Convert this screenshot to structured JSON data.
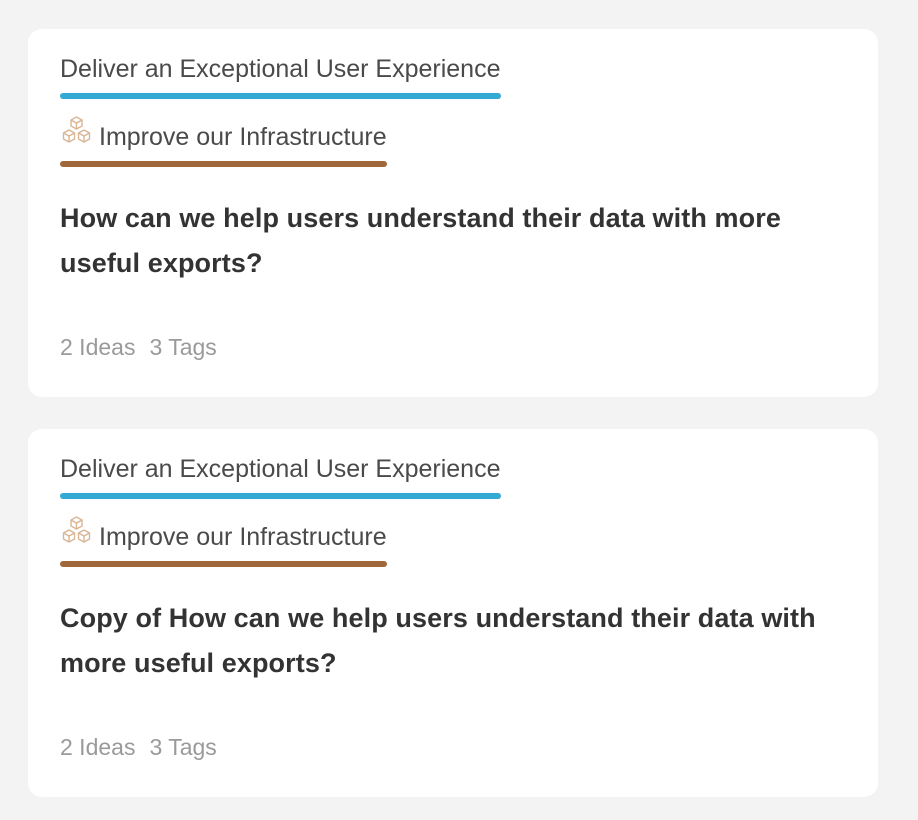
{
  "colors": {
    "page_background": "#f3f3f3",
    "card_background": "#ffffff",
    "goal_primary_bar": "#33a9d3",
    "goal_secondary_bar": "#a0673b",
    "cube_icon": "#d9b594"
  },
  "cards": [
    {
      "primary_goal": "Deliver an Exceptional User Experience",
      "secondary_goal": {
        "icon": "cubes-icon",
        "label": "Improve our Infrastructure"
      },
      "question": "How can we help users understand their data with more useful exports?",
      "ideas": "2 Ideas",
      "tags": "3 Tags"
    },
    {
      "primary_goal": "Deliver an Exceptional User Experience",
      "secondary_goal": {
        "icon": "cubes-icon",
        "label": "Improve our Infrastructure"
      },
      "question": "Copy of How can we help users understand their data with more useful exports?",
      "ideas": "2 Ideas",
      "tags": "3 Tags"
    }
  ]
}
